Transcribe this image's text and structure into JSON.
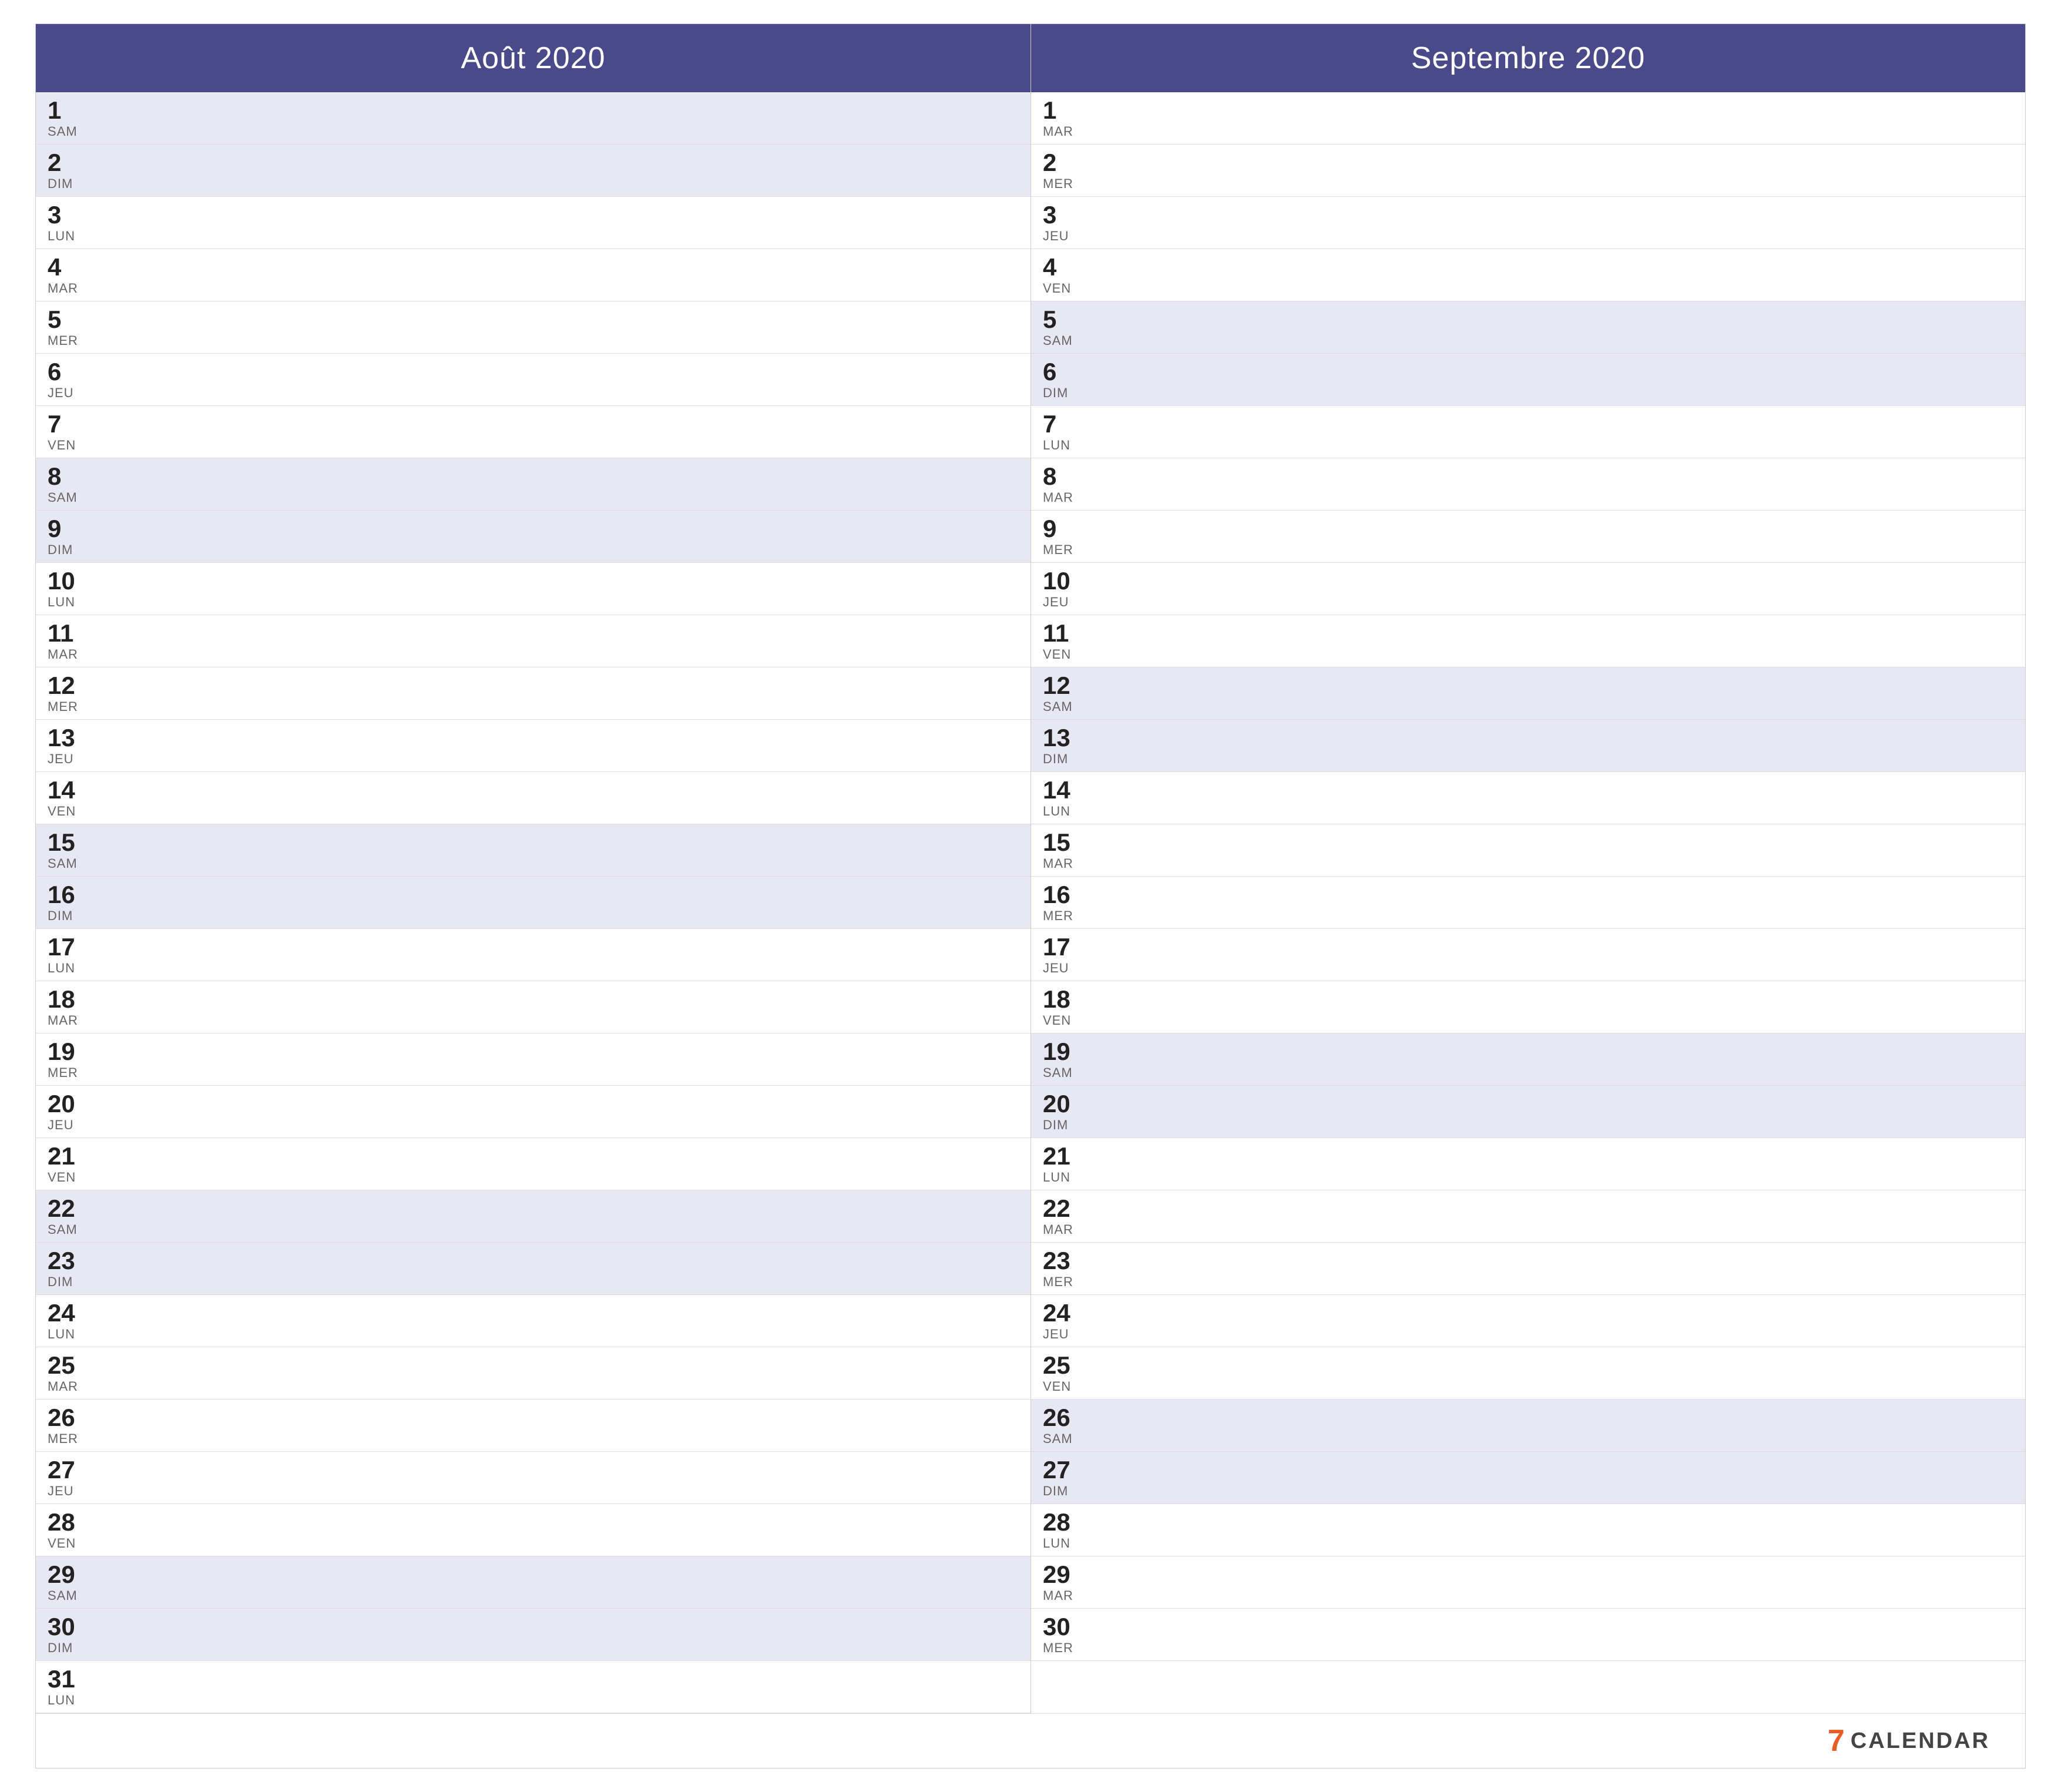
{
  "months": [
    {
      "title": "Août 2020",
      "days": [
        {
          "number": "1",
          "name": "SAM",
          "weekend": true
        },
        {
          "number": "2",
          "name": "DIM",
          "weekend": true
        },
        {
          "number": "3",
          "name": "LUN",
          "weekend": false
        },
        {
          "number": "4",
          "name": "MAR",
          "weekend": false
        },
        {
          "number": "5",
          "name": "MER",
          "weekend": false
        },
        {
          "number": "6",
          "name": "JEU",
          "weekend": false
        },
        {
          "number": "7",
          "name": "VEN",
          "weekend": false
        },
        {
          "number": "8",
          "name": "SAM",
          "weekend": true
        },
        {
          "number": "9",
          "name": "DIM",
          "weekend": true
        },
        {
          "number": "10",
          "name": "LUN",
          "weekend": false
        },
        {
          "number": "11",
          "name": "MAR",
          "weekend": false
        },
        {
          "number": "12",
          "name": "MER",
          "weekend": false
        },
        {
          "number": "13",
          "name": "JEU",
          "weekend": false
        },
        {
          "number": "14",
          "name": "VEN",
          "weekend": false
        },
        {
          "number": "15",
          "name": "SAM",
          "weekend": true
        },
        {
          "number": "16",
          "name": "DIM",
          "weekend": true
        },
        {
          "number": "17",
          "name": "LUN",
          "weekend": false
        },
        {
          "number": "18",
          "name": "MAR",
          "weekend": false
        },
        {
          "number": "19",
          "name": "MER",
          "weekend": false
        },
        {
          "number": "20",
          "name": "JEU",
          "weekend": false
        },
        {
          "number": "21",
          "name": "VEN",
          "weekend": false
        },
        {
          "number": "22",
          "name": "SAM",
          "weekend": true
        },
        {
          "number": "23",
          "name": "DIM",
          "weekend": true
        },
        {
          "number": "24",
          "name": "LUN",
          "weekend": false
        },
        {
          "number": "25",
          "name": "MAR",
          "weekend": false
        },
        {
          "number": "26",
          "name": "MER",
          "weekend": false
        },
        {
          "number": "27",
          "name": "JEU",
          "weekend": false
        },
        {
          "number": "28",
          "name": "VEN",
          "weekend": false
        },
        {
          "number": "29",
          "name": "SAM",
          "weekend": true
        },
        {
          "number": "30",
          "name": "DIM",
          "weekend": true
        },
        {
          "number": "31",
          "name": "LUN",
          "weekend": false
        }
      ]
    },
    {
      "title": "Septembre 2020",
      "days": [
        {
          "number": "1",
          "name": "MAR",
          "weekend": false
        },
        {
          "number": "2",
          "name": "MER",
          "weekend": false
        },
        {
          "number": "3",
          "name": "JEU",
          "weekend": false
        },
        {
          "number": "4",
          "name": "VEN",
          "weekend": false
        },
        {
          "number": "5",
          "name": "SAM",
          "weekend": true
        },
        {
          "number": "6",
          "name": "DIM",
          "weekend": true
        },
        {
          "number": "7",
          "name": "LUN",
          "weekend": false
        },
        {
          "number": "8",
          "name": "MAR",
          "weekend": false
        },
        {
          "number": "9",
          "name": "MER",
          "weekend": false
        },
        {
          "number": "10",
          "name": "JEU",
          "weekend": false
        },
        {
          "number": "11",
          "name": "VEN",
          "weekend": false
        },
        {
          "number": "12",
          "name": "SAM",
          "weekend": true
        },
        {
          "number": "13",
          "name": "DIM",
          "weekend": true
        },
        {
          "number": "14",
          "name": "LUN",
          "weekend": false
        },
        {
          "number": "15",
          "name": "MAR",
          "weekend": false
        },
        {
          "number": "16",
          "name": "MER",
          "weekend": false
        },
        {
          "number": "17",
          "name": "JEU",
          "weekend": false
        },
        {
          "number": "18",
          "name": "VEN",
          "weekend": false
        },
        {
          "number": "19",
          "name": "SAM",
          "weekend": true
        },
        {
          "number": "20",
          "name": "DIM",
          "weekend": true
        },
        {
          "number": "21",
          "name": "LUN",
          "weekend": false
        },
        {
          "number": "22",
          "name": "MAR",
          "weekend": false
        },
        {
          "number": "23",
          "name": "MER",
          "weekend": false
        },
        {
          "number": "24",
          "name": "JEU",
          "weekend": false
        },
        {
          "number": "25",
          "name": "VEN",
          "weekend": false
        },
        {
          "number": "26",
          "name": "SAM",
          "weekend": true
        },
        {
          "number": "27",
          "name": "DIM",
          "weekend": true
        },
        {
          "number": "28",
          "name": "LUN",
          "weekend": false
        },
        {
          "number": "29",
          "name": "MAR",
          "weekend": false
        },
        {
          "number": "30",
          "name": "MER",
          "weekend": false
        }
      ]
    }
  ],
  "footer": {
    "brand_icon": "7",
    "brand_label": "CALENDAR"
  }
}
